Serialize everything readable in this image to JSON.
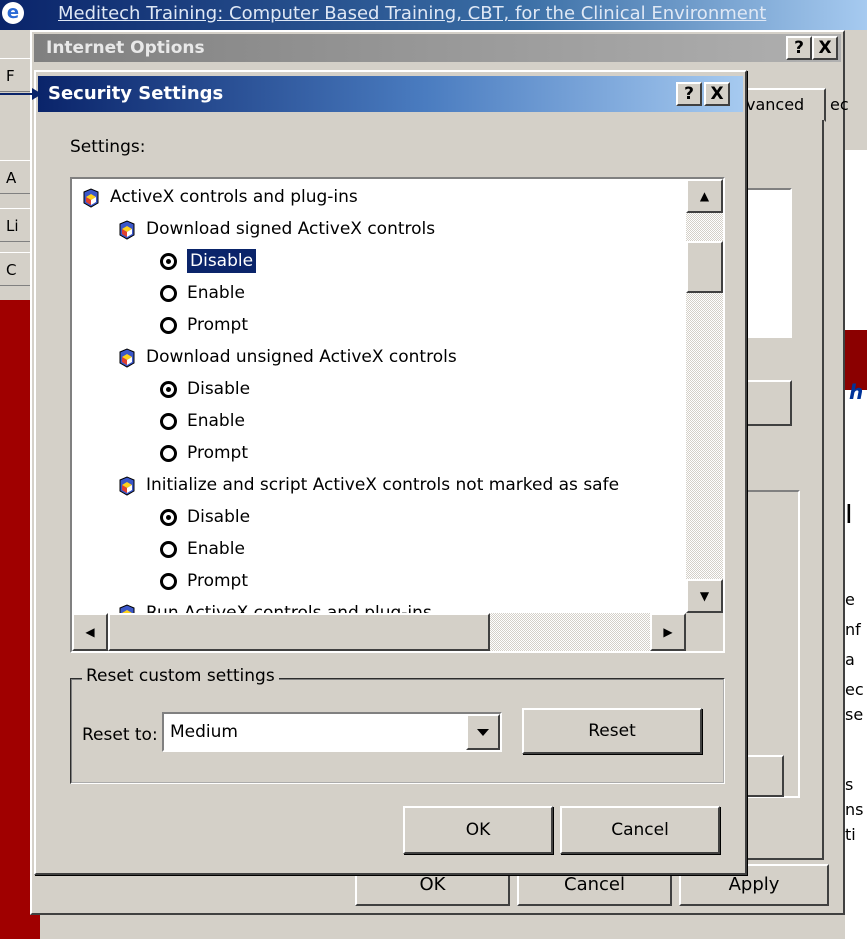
{
  "browser": {
    "title": "Meditech Training: Computer Based Training, CBT, for the Clinical Environment",
    "strip_labels": [
      "F",
      "A",
      "Li",
      "C"
    ],
    "right_fragments": [
      "ec",
      "I",
      "e",
      "nf",
      "a",
      "ec",
      "se",
      "s",
      "ns",
      "ti"
    ],
    "right_heading_fragment": "h"
  },
  "internet_options": {
    "title": "Internet Options",
    "help_label": "?",
    "close_label": "X",
    "tab_advanced": "vanced",
    "tab_next": "ec",
    "ok_label": "OK",
    "cancel_label": "Cancel",
    "apply_label": "Apply"
  },
  "security_settings": {
    "title": "Security Settings",
    "help_label": "?",
    "close_label": "X",
    "settings_label": "Settings:",
    "tree": [
      {
        "level": 0,
        "kind": "folder",
        "label": "ActiveX controls and plug-ins"
      },
      {
        "level": 1,
        "kind": "folder",
        "label": "Download signed ActiveX controls"
      },
      {
        "level": 2,
        "kind": "radio",
        "label": "Disable",
        "checked": true,
        "selected": true
      },
      {
        "level": 2,
        "kind": "radio",
        "label": "Enable",
        "checked": false
      },
      {
        "level": 2,
        "kind": "radio",
        "label": "Prompt",
        "checked": false
      },
      {
        "level": 1,
        "kind": "folder",
        "label": "Download unsigned ActiveX controls"
      },
      {
        "level": 2,
        "kind": "radio",
        "label": "Disable",
        "checked": true
      },
      {
        "level": 2,
        "kind": "radio",
        "label": "Enable",
        "checked": false
      },
      {
        "level": 2,
        "kind": "radio",
        "label": "Prompt",
        "checked": false
      },
      {
        "level": 1,
        "kind": "folder",
        "label": "Initialize and script ActiveX controls not marked as safe"
      },
      {
        "level": 2,
        "kind": "radio",
        "label": "Disable",
        "checked": true
      },
      {
        "level": 2,
        "kind": "radio",
        "label": "Enable",
        "checked": false
      },
      {
        "level": 2,
        "kind": "radio",
        "label": "Prompt",
        "checked": false
      },
      {
        "level": 1,
        "kind": "folder",
        "label": "Run ActiveX controls and plug-ins"
      }
    ],
    "reset_group_label": "Reset custom settings",
    "reset_to_label": "Reset to:",
    "reset_to_value": "Medium",
    "reset_button": "Reset",
    "ok_label": "OK",
    "cancel_label": "Cancel"
  },
  "colors": {
    "active_title": "#0a246a",
    "dialog_face": "#d4d0c8",
    "selection": "#0a246a",
    "page_red": "#a00000"
  }
}
